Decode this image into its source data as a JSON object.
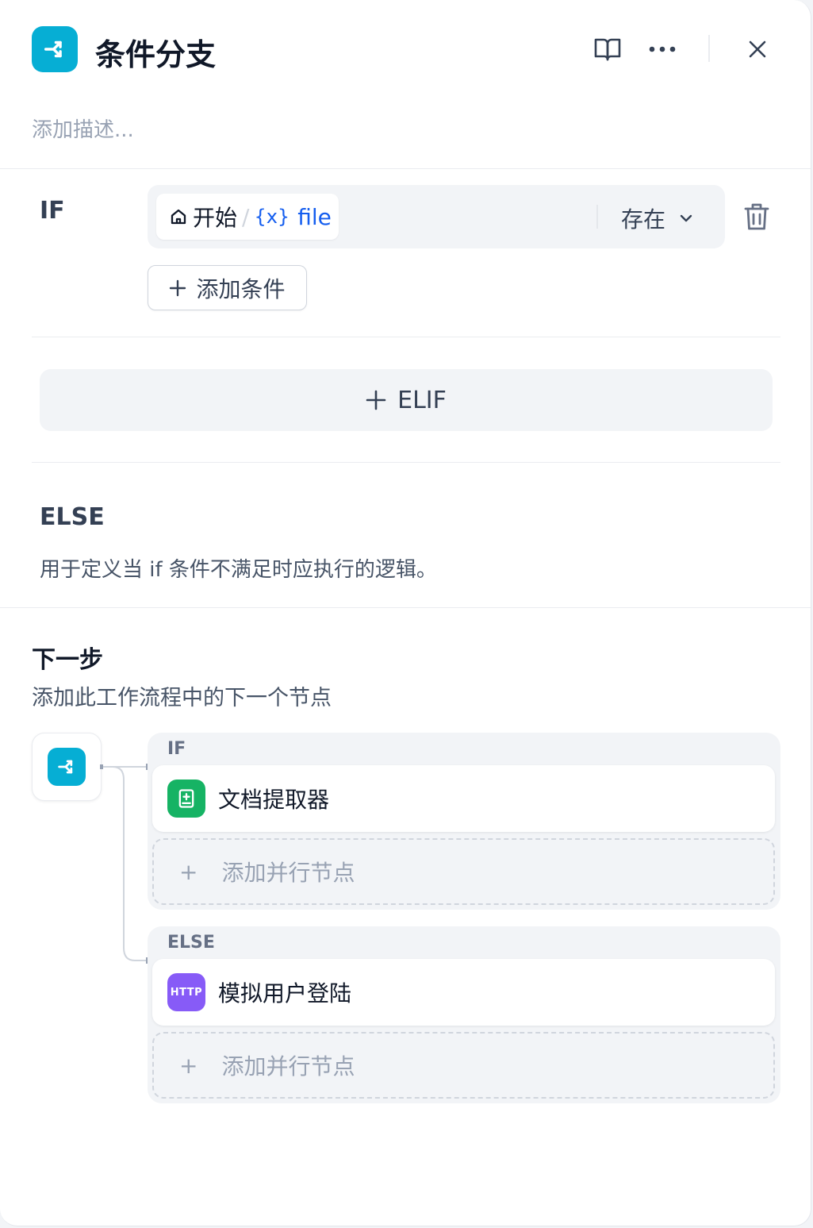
{
  "header": {
    "title": "条件分支",
    "description_placeholder": "添加描述..."
  },
  "if_case": {
    "label": "IF",
    "condition": {
      "source_node": "开始",
      "separator": "/",
      "var_glyph": "{x}",
      "variable": "file",
      "operator": "存在"
    },
    "add_condition_label": "添加条件"
  },
  "elif": {
    "label": "ELIF"
  },
  "else_case": {
    "label": "ELSE",
    "description": "用于定义当 if 条件不满足时应执行的逻辑。"
  },
  "next_step": {
    "title": "下一步",
    "subtitle": "添加此工作流程中的下一个节点",
    "branches": [
      {
        "label": "IF",
        "node_name": "文档提取器",
        "node_icon": "doc-extractor-icon",
        "add_parallel_label": "添加并行节点"
      },
      {
        "label": "ELSE",
        "node_name": "模拟用户登陆",
        "node_icon_text": "HTTP",
        "add_parallel_label": "添加并行节点"
      }
    ]
  },
  "colors": {
    "brand": "#06aed4",
    "extractor_green": "#16b364",
    "http_purple": "#875bf7",
    "variable_blue": "#155eef"
  }
}
